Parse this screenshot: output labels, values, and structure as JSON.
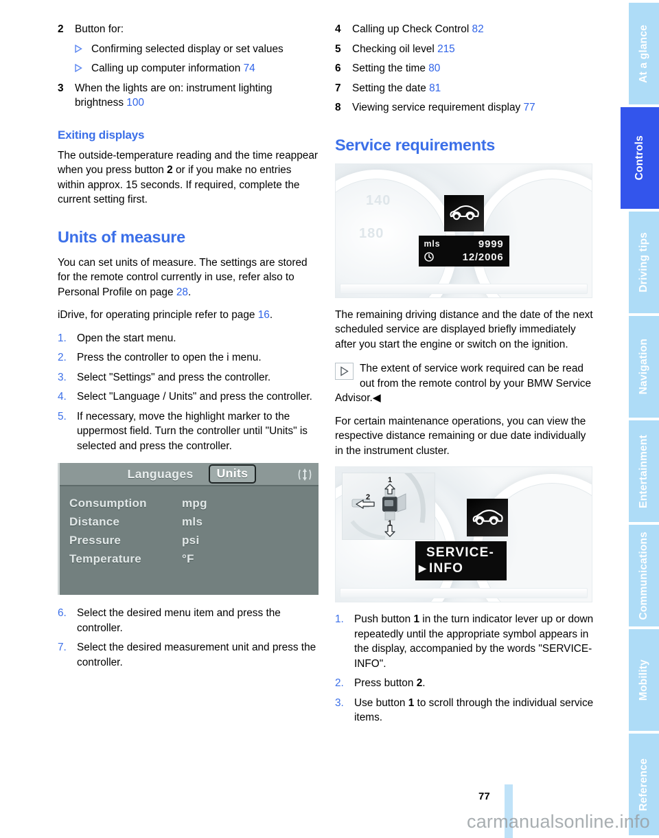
{
  "document": {
    "page_number": "77",
    "watermark": "carmanualsonline.info"
  },
  "sidebar": {
    "tabs": [
      {
        "label": "At a glance",
        "active": false
      },
      {
        "label": "Controls",
        "active": true
      },
      {
        "label": "Driving tips",
        "active": false
      },
      {
        "label": "Navigation",
        "active": false
      },
      {
        "label": "Entertainment",
        "active": false
      },
      {
        "label": "Communications",
        "active": false
      },
      {
        "label": "Mobility",
        "active": false
      },
      {
        "label": "Reference",
        "active": false
      }
    ],
    "colors": {
      "inactive": "#aedcf7",
      "active": "#3355ec",
      "text": "#ffffff"
    }
  },
  "left_column": {
    "key_items": [
      {
        "num": "2",
        "text": "Button for:"
      },
      {
        "num": "3",
        "text": "When the lights are on: instrument lighting brightness",
        "page": "100"
      }
    ],
    "bullets": [
      {
        "text": "Confirming selected display or set values",
        "page": ""
      },
      {
        "text": "Calling up computer information",
        "page": "74"
      }
    ],
    "exiting_displays": {
      "heading": "Exiting displays",
      "body_part1": "The outside-temperature reading and the time reappear when you press button ",
      "body_bold": "2",
      "body_part2": " or if you make no entries within approx. 15 seconds. If required, complete the current setting first."
    },
    "units_of_measure": {
      "heading": "Units of measure",
      "para1_a": "You can set units of measure. The settings are stored for the remote control currently in use, refer also to Personal Profile on page ",
      "para1_ref": "28",
      "para1_b": ".",
      "para2_a": "iDrive, for operating principle refer to page ",
      "para2_ref": "16",
      "para2_b": ".",
      "steps_before": [
        {
          "num": "1.",
          "text": "Open the start menu."
        },
        {
          "num": "2.",
          "text": "Press the controller to open the  i  menu."
        },
        {
          "num": "3.",
          "text": "Select \"Settings\" and press the controller."
        },
        {
          "num": "4.",
          "text": "Select \"Language / Units\" and press the controller."
        },
        {
          "num": "5.",
          "text": "If necessary, move the highlight marker to the uppermost field. Turn the controller until \"Units\" is selected and press the controller."
        }
      ],
      "steps_after": [
        {
          "num": "6.",
          "text": "Select the desired menu item and press the controller."
        },
        {
          "num": "7.",
          "text": "Select the desired measurement unit and press the controller."
        }
      ]
    },
    "idrive_figure": {
      "tab_inactive": "Languages",
      "tab_active": "Units",
      "scroll_icon": "updown-scroll-icon",
      "rows": [
        {
          "label": "Consumption",
          "value": "mpg"
        },
        {
          "label": "Distance",
          "value": "mls"
        },
        {
          "label": "Pressure",
          "value": "psi"
        },
        {
          "label": "Temperature",
          "value": "°F"
        }
      ]
    }
  },
  "right_column": {
    "key_items": [
      {
        "num": "4",
        "text": "Calling up Check Control",
        "page": "82"
      },
      {
        "num": "5",
        "text": "Checking oil level",
        "page": "215"
      },
      {
        "num": "6",
        "text": "Setting the time",
        "page": "80"
      },
      {
        "num": "7",
        "text": "Setting the date",
        "page": "81"
      },
      {
        "num": "8",
        "text": "Viewing service requirement display",
        "page": "77"
      }
    ],
    "service_requirements": {
      "heading": "Service requirements",
      "para1": "The remaining driving distance and the date of the next scheduled service are displayed briefly immediately after you start the engine or switch on the ignition.",
      "note": "The extent of service work required can be read out from the remote control by your BMW Service Advisor.",
      "note_icon": "play-triangle-icon",
      "note_end_marker": "◀",
      "para2": "For certain maintenance operations, you can view the respective distance remaining or due date individually in the instrument cluster.",
      "steps": [
        {
          "num": "1.",
          "text_a": "Push button ",
          "bold": "1",
          "text_b": " in the turn indicator lever up or down repeatedly until the appropriate symbol appears in the display, accompanied by the words \"SERVICE-INFO\"."
        },
        {
          "num": "2.",
          "text_a": "Press button ",
          "bold": "2",
          "text_b": "."
        },
        {
          "num": "3.",
          "text_a": "Use button ",
          "bold": "1",
          "text_b": " to scroll through the individual service items."
        }
      ]
    },
    "cluster_figure_1": {
      "icon": "car-silhouette-icon",
      "distance_unit": "mls",
      "distance_value": "9999",
      "clock_icon": "clock-icon",
      "date_value": "12/2006",
      "dial_tick_left_top": "140",
      "dial_tick_left_bottom": "180"
    },
    "cluster_figure_2": {
      "icon": "car-silhouette-icon",
      "display_line1": "SERVICE-",
      "display_line2": "INFO",
      "display_marker": "▶",
      "lever_callout_up": "1",
      "lever_callout_down": "1",
      "lever_callout_press": "2"
    }
  },
  "colors": {
    "heading_blue": "#3b6fe8",
    "page_ref_blue": "#2f63e8",
    "sidebar_light": "#aedcf7",
    "sidebar_active": "#3355ec",
    "idrive_panel": "#73807f"
  }
}
